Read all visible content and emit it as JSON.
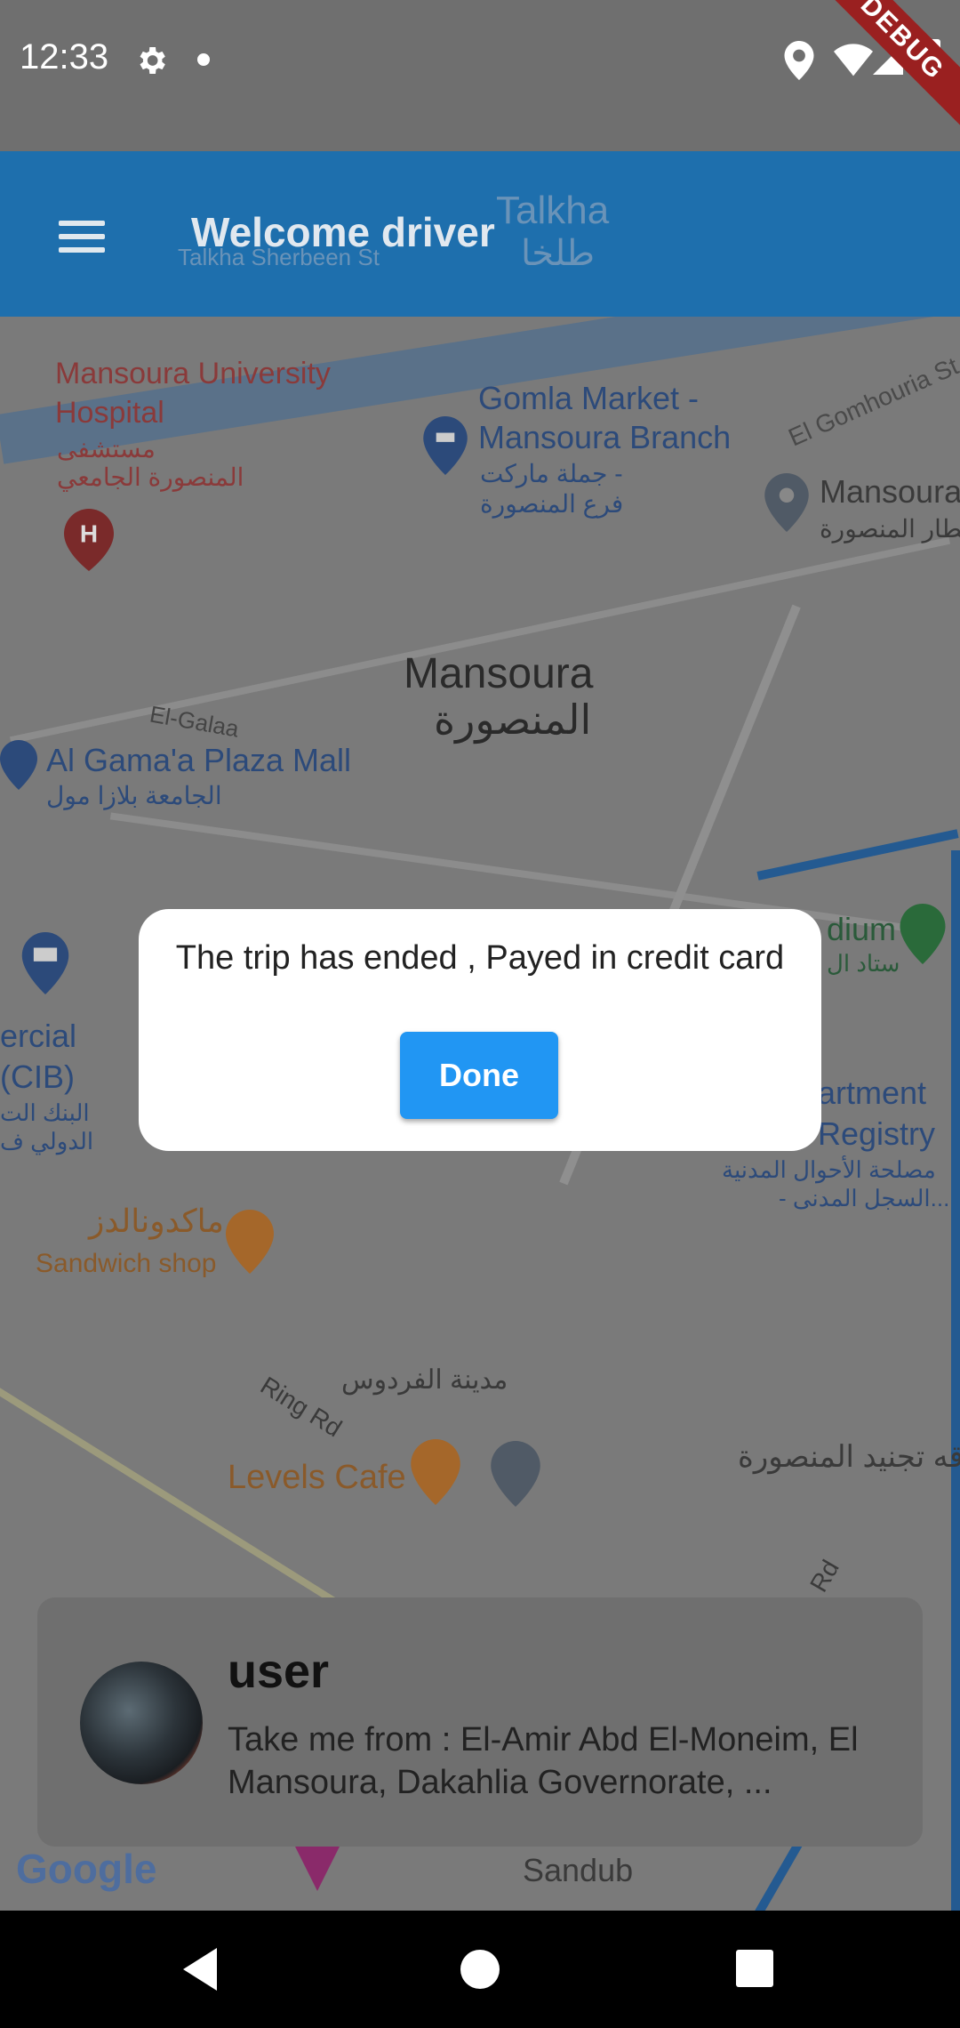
{
  "status_bar": {
    "time": "12:33",
    "debug_label": "DEBUG"
  },
  "app_bar": {
    "title": "Welcome driver"
  },
  "map": {
    "labels": {
      "hospital": "Mansoura University Hospital",
      "hospital_ar_1": "مستشفى",
      "hospital_ar_2": "المنصورة الجامعي",
      "gomla": "Gomla Market - Mansoura Branch",
      "gomla_ar_1": "جملة ماركت -",
      "gomla_ar_2": "فرع المنصورة",
      "city": "Mansoura",
      "city_ar": "المنصورة",
      "mall": "Al Gama'a Plaza Mall",
      "mall_ar": "الجامعة بلازا مول",
      "egalaa": "El-Galaa",
      "talkha": "Talkha",
      "talkha_ar": "طلخا",
      "talkha_sherbeen": "Talkha Sherbeen St",
      "gomhouria": "El Gomhouria St",
      "mansoura_station": "Mansoura",
      "mansoura_station_ar": "قطار المنصورة",
      "stadium": "dium",
      "stadium_ar": "ستاد ال",
      "cib_1": "ercial",
      "cib_2": "(CIB)",
      "cib_ar_1": "البنك الت",
      "cib_ar_2": "الدولي ف",
      "registry_1": "artment",
      "registry_2": "Registry",
      "registry_ar_1": "مصلحة الأحوال المدنية",
      "registry_ar_2": "- السجل المدنى...",
      "mcd_ar": "ماكدونالدز",
      "sandwich": "Sandwich shop",
      "ferdous_ar": "مدينة الفردوس",
      "ring_rd": "Ring Rd",
      "levels": "Levels Cafe",
      "tagneed_ar": "قه تجنيد المنصورة",
      "sandub": "Sandub",
      "rd": "Rd",
      "google": "Google"
    }
  },
  "dialog": {
    "message": "The trip has ended , Payed in credit card",
    "button_label": "Done"
  },
  "request_card": {
    "rider_name": "user",
    "pickup": "Take me from : El-Amir Abd El-Moneim, El Mansoura, Dakahlia Governorate, ..."
  },
  "colors": {
    "app_bar": "#1e6fad",
    "button": "#2196f3",
    "scrim_map": "#7a7a7a"
  }
}
